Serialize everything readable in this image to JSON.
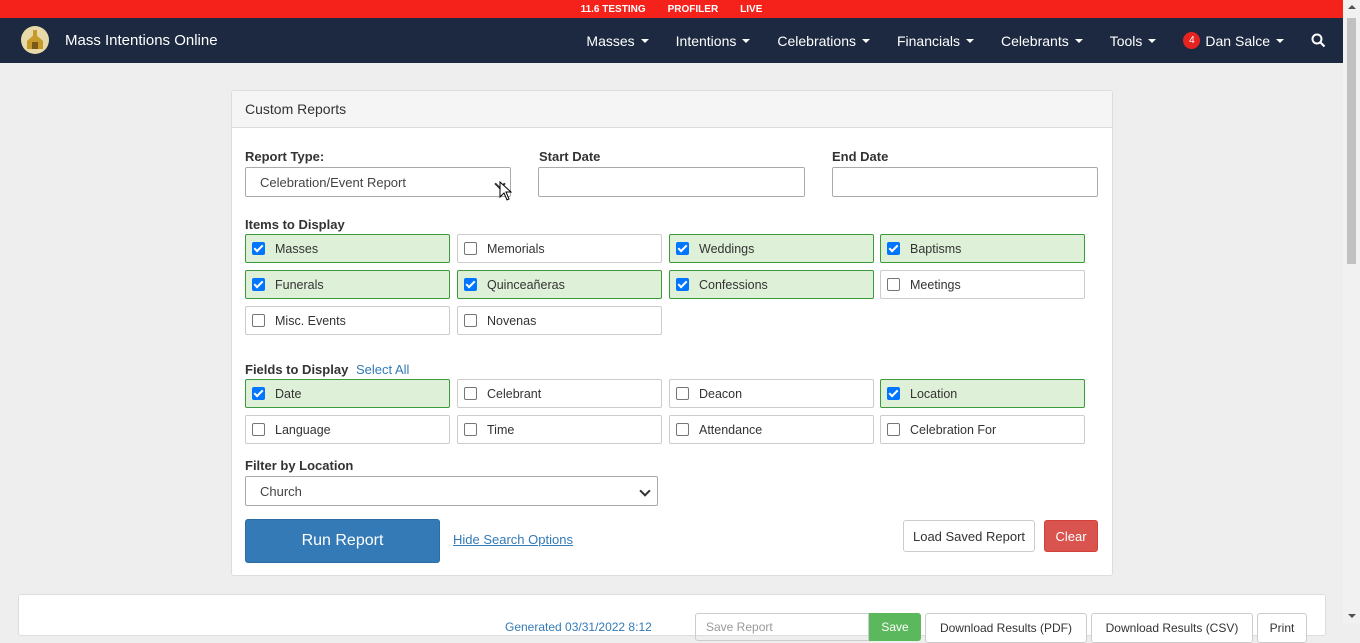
{
  "topbar": {
    "items": [
      "11.6 TESTING",
      "PROFILER",
      "LIVE"
    ]
  },
  "nav": {
    "brand": "Mass Intentions Online",
    "menu": [
      "Masses",
      "Intentions",
      "Celebrations",
      "Financials",
      "Celebrants",
      "Tools"
    ],
    "user": {
      "badge": "4",
      "name": "Dan Salce"
    }
  },
  "panel": {
    "heading": "Custom Reports",
    "report_type": {
      "label": "Report Type:",
      "value": "Celebration/Event Report"
    },
    "start_date": {
      "label": "Start Date",
      "value": ""
    },
    "end_date": {
      "label": "End Date",
      "value": ""
    },
    "items": {
      "label": "Items to Display",
      "options": [
        {
          "label": "Masses",
          "checked": true
        },
        {
          "label": "Memorials",
          "checked": false
        },
        {
          "label": "Weddings",
          "checked": true
        },
        {
          "label": "Baptisms",
          "checked": true
        },
        {
          "label": "Funerals",
          "checked": true
        },
        {
          "label": "Quinceañeras",
          "checked": true
        },
        {
          "label": "Confessions",
          "checked": true
        },
        {
          "label": "Meetings",
          "checked": false
        },
        {
          "label": "Misc. Events",
          "checked": false
        },
        {
          "label": "Novenas",
          "checked": false
        }
      ]
    },
    "fields": {
      "label": "Fields to Display",
      "select_all": "Select All",
      "options": [
        {
          "label": "Date",
          "checked": true
        },
        {
          "label": "Celebrant",
          "checked": false
        },
        {
          "label": "Deacon",
          "checked": false
        },
        {
          "label": "Location",
          "checked": true
        },
        {
          "label": "Language",
          "checked": false
        },
        {
          "label": "Time",
          "checked": false
        },
        {
          "label": "Attendance",
          "checked": false
        },
        {
          "label": "Celebration For",
          "checked": false
        }
      ]
    },
    "location": {
      "label": "Filter by Location",
      "value": "Church"
    },
    "run_button": "Run Report",
    "hide_link": "Hide Search Options",
    "load_button": "Load Saved Report",
    "clear_button": "Clear"
  },
  "results": {
    "generated": "Generated 03/31/2022 8:12",
    "report_name_placeholder": "Save Report",
    "save": "Save",
    "pdf": "Download Results (PDF)",
    "csv": "Download Results (CSV)",
    "print": "Print"
  },
  "colors": {
    "topbar": "#f4221a",
    "navbar": "#1c2940",
    "primary": "#337ab7",
    "danger": "#d9534f",
    "checked_bg": "#dff0d8"
  }
}
